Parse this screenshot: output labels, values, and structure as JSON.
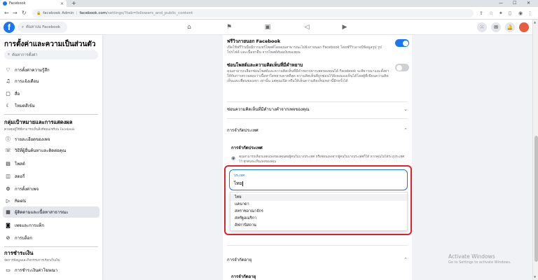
{
  "browser": {
    "tab_title": "Facebook",
    "tab_close": "×",
    "new_tab": "+",
    "win_min": "—",
    "win_max": "☐",
    "win_close": "✕",
    "site_label": "facebook Admin",
    "url_host": "facebook.com",
    "url_path": "/settings/?tab=followers_and_public_content",
    "back": "←",
    "forward": "→",
    "reload": "↻"
  },
  "fb": {
    "logo": "f",
    "search_placeholder": "ค้นหาบน Facebook"
  },
  "sidebar": {
    "title": "การตั้งค่าและความเป็นส่วนตัว",
    "search_placeholder": "ค้นหาการตั้งค่า",
    "items_top": [
      {
        "label": "การตั้งค่าความรู้สึก",
        "icon": "heart-icon"
      },
      {
        "label": "การแจ้งเตือน",
        "icon": "bell-icon"
      },
      {
        "label": "สื่อ",
        "icon": "media-icon"
      },
      {
        "label": "โหมดสีเข้ม",
        "icon": "moon-icon"
      }
    ],
    "section1_title": "กลุ่มเป้าหมายและการแสดงผล",
    "section1_sub": "ควบคุมผู้ใช้ที่สามารถเห็นสิ่งที่คุณแชร์บน Facebook",
    "items_mid": [
      {
        "label": "รายละเอียดของเพจ",
        "icon": "info-icon"
      },
      {
        "label": "วิธีที่ผู้อื่นค้นหาและติดต่อคุณ",
        "icon": "contact-icon"
      },
      {
        "label": "โพสต์",
        "icon": "post-icon"
      },
      {
        "label": "สตอรี่",
        "icon": "story-icon"
      },
      {
        "label": "การตั้งค่าเพจ",
        "icon": "page-icon"
      },
      {
        "label": "Reels",
        "icon": "reels-icon"
      },
      {
        "label": "ผู้ติดตามและเนื้อหาสาธารณะ",
        "icon": "followers-icon",
        "active": true
      },
      {
        "label": "เพจและการแท็ก",
        "icon": "tag-icon"
      },
      {
        "label": "การบล็อก",
        "icon": "block-icon"
      }
    ],
    "section2_title": "การชำระเงิน",
    "section2_sub": "จัดการข้อมูลและกิจกรรมการเรียกเก็บเงิน",
    "items_bottom": [
      {
        "label": "การชำระเงินค่าโฆษณา",
        "icon": "payment-icon"
      }
    ]
  },
  "panel": {
    "setting1_title": "ฟรีวิวภายนอก Facebook",
    "setting1_desc": "เปิดใช้ฟรีวิวเมื่อมีการแชร์โพสต์โดยคุณสาธารณะไปยังภายนอก Facebook โดยฟรีวิวอาจมีข้อมูลรูป รูปโปรไฟล์ และเนื้อหาอื่น จากโพสต์ต้นฉบับของคุณ",
    "setting2_title": "ซ่อนโพสต์และความคิดเห็นที่มีคำหยาบ",
    "setting2_desc": "คุณสามารถเลือกซ่อนโพสต์และความคิดเห็นที่มีคำหยาบจากเพจของคุณได้ Facebook จะพิจารณาและตั้งค่าให้กับการตรวจสอบว่าเนื้อหาใดหยาบคายที่สุด ความคิดเห็นที่ถูกซ่อนไว้ยังคงมองเห็นได้โดยผู้ที่เขียนความคิดเห็นและเพื่อนของเขา เท่านั้น แต่คุณเปิด หรือให้เห็นความคิดเห็นเหล่านี้อีกครั้งได้",
    "acc1": "ซ่อนความคิดเห็นที่มีคำบางคำจากเพจของคุณ",
    "acc2": "การจำกัดประเทศ",
    "sub_title": "การจำกัดประเทศ",
    "eye_text": "คุณสามารถเลือกแสดงเพจของคุณต่อผู้คนในบางประเทศ หรือซ่อนเพจจากผู้คนในบางประเทศก็ได้ หากคุณไม่ได้ระบุประเทศไว้ ทุกคนจะเห็นเพจของคุณ",
    "combo_label": "ประเทศ",
    "combo_value": "ไทย",
    "options": [
      "ไทย",
      "แคนาดา",
      "สหราชอาณาจักร",
      "สหรัฐอเมริกา",
      "อัฟกานิสถาน"
    ],
    "acc3": "การจำกัดอายุ",
    "acc3_sub": "การจำกัดอายุ",
    "chev_down": "⌄",
    "chev_up": "⌃"
  },
  "watermark": {
    "line1": "Activate Windows",
    "line2": "Go to Settings to activate Windows."
  },
  "colors": {
    "accent": "#1877f2",
    "highlight": "#e4212a"
  }
}
